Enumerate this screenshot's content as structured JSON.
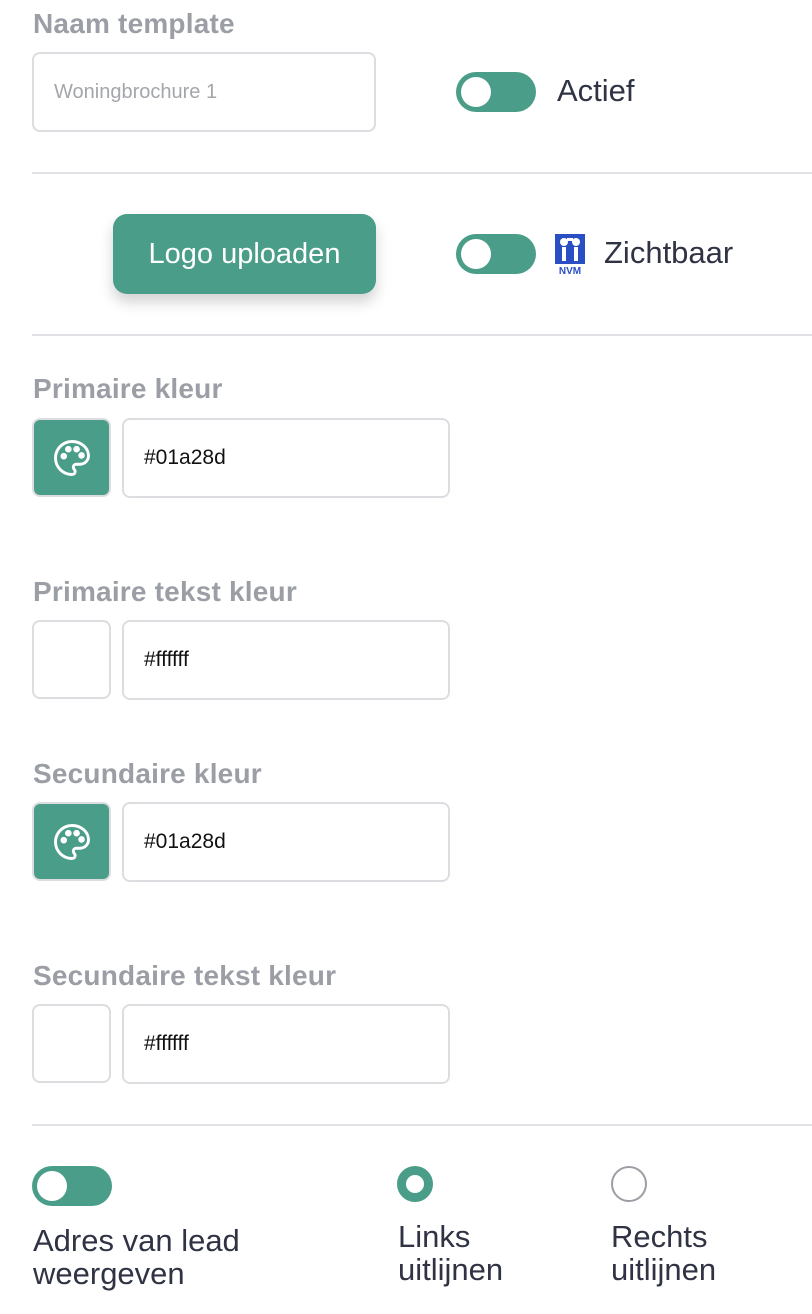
{
  "template_name": {
    "label": "Naam template",
    "placeholder": "Woningbrochure 1",
    "value": ""
  },
  "active_toggle": {
    "label": "Actief",
    "on": true
  },
  "logo": {
    "upload_label": "Logo uploaden",
    "visible_label": "Zichtbaar",
    "visible_on": true,
    "brand_text": "NVM",
    "brand_color": "#2a4fc4"
  },
  "colors": {
    "accent": "#4a9d88",
    "primary": {
      "label": "Primaire kleur",
      "value": "#01a28d",
      "swatch_icon": "palette-icon"
    },
    "primary_text": {
      "label": "Primaire tekst kleur",
      "value": "#ffffff"
    },
    "secondary": {
      "label": "Secundaire kleur",
      "value": "#01a28d",
      "swatch_icon": "palette-icon"
    },
    "secondary_text": {
      "label": "Secundaire tekst kleur",
      "value": "#ffffff"
    }
  },
  "address": {
    "toggle_on": true,
    "label_line1": "Adres van lead",
    "label_line2": "weergeven",
    "align_left_line1": "Links",
    "align_left_line2": "uitlijnen",
    "align_left_checked": true,
    "align_right_line1": "Rechts",
    "align_right_line2": "uitlijnen",
    "align_right_checked": false
  }
}
